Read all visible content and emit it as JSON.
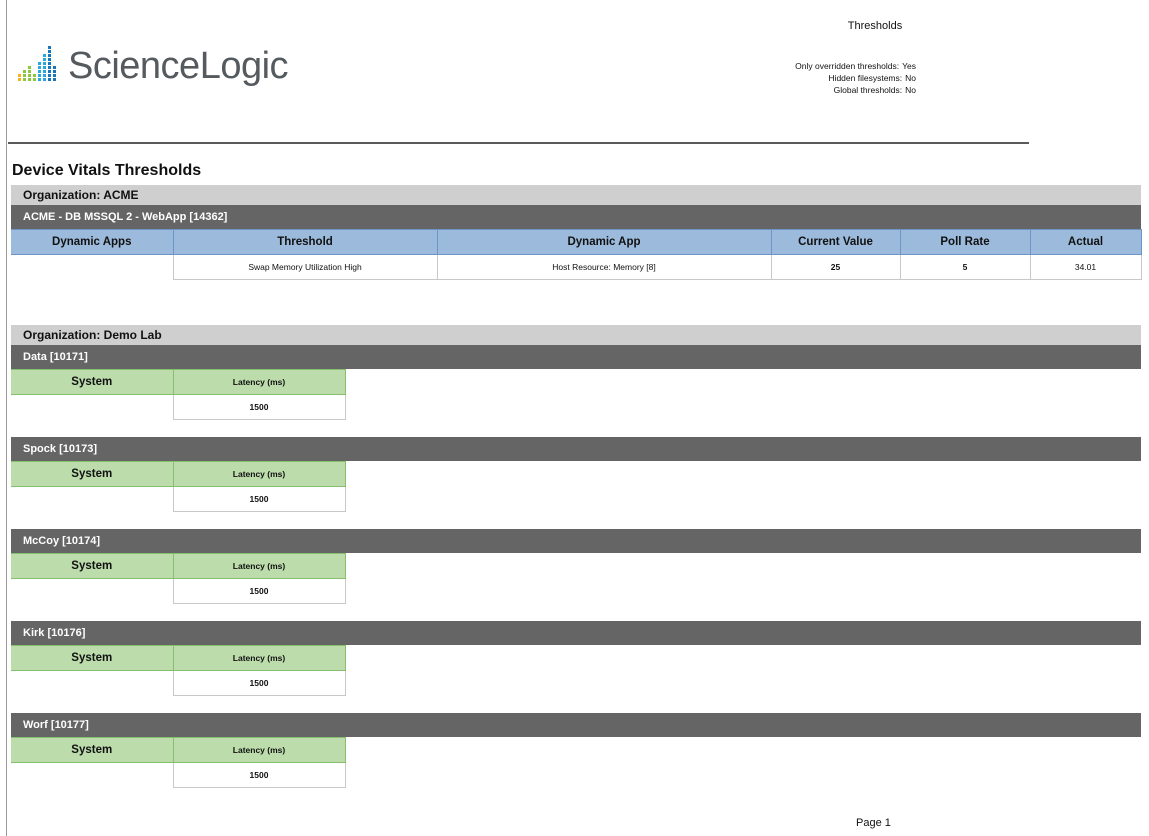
{
  "brand": {
    "name": "ScienceLogic",
    "icon": "sciencelogic-bars-logo",
    "colors": [
      "#f7b21b",
      "#8cc63f",
      "#2aa7df",
      "#1a75bb"
    ]
  },
  "report": {
    "title": "Thresholds",
    "meta": [
      {
        "label": "Only overridden thresholds:",
        "value": "Yes"
      },
      {
        "label": "Hidden filesystems:",
        "value": "No"
      },
      {
        "label": "Global thresholds:",
        "value": "No"
      }
    ],
    "section_title": "Device Vitals Thresholds",
    "page_label": "Page 1"
  },
  "orgs": [
    {
      "name": "Organization: ACME",
      "devices": [
        {
          "name": "ACME - DB MSSQL 2 - WebApp [14362]",
          "table": {
            "headers": [
              "Dynamic Apps",
              "Threshold",
              "Dynamic App",
              "Current Value",
              "Poll Rate",
              "Actual"
            ],
            "rows": [
              [
                "",
                "Swap Memory Utilization High",
                "Host Resource: Memory [8]",
                "25",
                "5",
                "34.01"
              ]
            ]
          }
        }
      ]
    },
    {
      "name": "Organization: Demo Lab",
      "devices": [
        {
          "name": "Data [10171]",
          "system_header": "System",
          "latency_header": "Latency (ms)",
          "latency_value": "1500"
        },
        {
          "name": "Spock [10173]",
          "system_header": "System",
          "latency_header": "Latency (ms)",
          "latency_value": "1500"
        },
        {
          "name": "McCoy [10174]",
          "system_header": "System",
          "latency_header": "Latency (ms)",
          "latency_value": "1500"
        },
        {
          "name": "Kirk [10176]",
          "system_header": "System",
          "latency_header": "Latency (ms)",
          "latency_value": "1500"
        },
        {
          "name": "Worf [10177]",
          "system_header": "System",
          "latency_header": "Latency (ms)",
          "latency_value": "1500"
        }
      ]
    }
  ]
}
